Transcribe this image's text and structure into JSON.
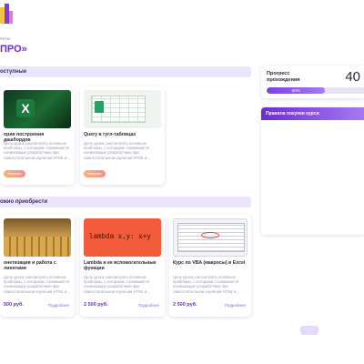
{
  "header": {
    "breadcrumb": "енты",
    "title": "ПРО»"
  },
  "sections": {
    "available": "оступные",
    "buy": "ожно приобрести"
  },
  "available_cards": [
    {
      "title": "ория построения дашбордов",
      "desc": "Цель урока: рассмотреть основные проблемы, с которыми сталкиваются начинающие разработчики при самостоятельном изучении HTML и...",
      "button": "Изучать"
    },
    {
      "title": "Query в гугл-таблицах",
      "desc": "Цель урока: рассмотреть основные проблемы, с которыми сталкиваются начинающие разработчики при самостоятельном изучении HTML и...",
      "button": "Изучать"
    }
  ],
  "buy_cards": [
    {
      "title": "онетизация и работа с лиентами",
      "desc": "Цель урока: рассмотреть основные проблемы, с которыми сталкиваются начинающие разработчики при самостоятельном изучении HTML и...",
      "price": "500 руб.",
      "more": "Подробнее"
    },
    {
      "title": "Lambda и ее вспомогательные функции",
      "desc": "Цель урока: рассмотреть основные проблемы, с которыми сталкиваются начинающие разработчики при самостоятельном изучении HTML и...",
      "price": "2 500 руб.",
      "more": "Подробнее",
      "code": "lambda x,y: x+y"
    },
    {
      "title": "Курс по VBA (макросы) в Excel",
      "desc": "Цель урока: рассмотреть основные проблемы, с которыми сталкиваются начинающие разработчики при самостоятельном изучении HTML и...",
      "price": "2 500 руб.",
      "more": "Подробнее"
    }
  ],
  "progress": {
    "label": "Прогресс прохождения",
    "number": "40",
    "percent_text": "60%",
    "fraction": 0.6
  },
  "rules": {
    "title": "Правила покупки курса:"
  },
  "colors": {
    "accent": "#6c2bd9",
    "section_bg": "#ece4fb",
    "lambda_bg": "#f25c3b"
  }
}
